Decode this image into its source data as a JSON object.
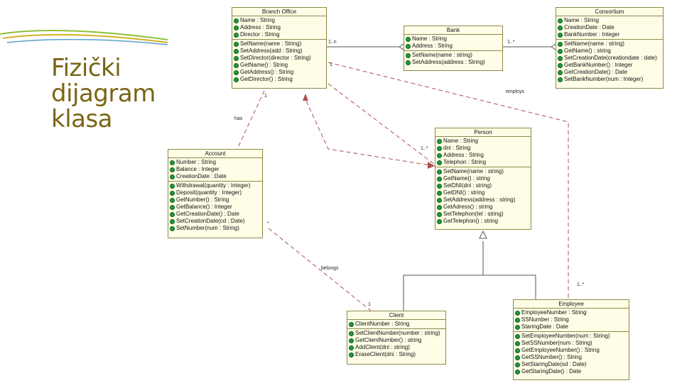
{
  "slide_title": "Fizički dijagram klasa",
  "colors": {
    "title": "#7a6414",
    "class_fill": "#fffde6",
    "class_border": "#8a8a4a",
    "icon_green": "#1e9a3a",
    "line_red": "#b05050"
  },
  "classes": {
    "branch_office": {
      "name": "Branch Office",
      "attributes": [
        "Name : String",
        "Address : String",
        "Director : String"
      ],
      "operations": [
        "SetName(name : String)",
        "SetAddress(add : String)",
        "SetDirector(director : String)",
        "GetName() : String",
        "GetAddress() : String",
        "GetDirector() : String"
      ]
    },
    "bank": {
      "name": "Bank",
      "attributes": [
        "Name : String",
        "Address : String"
      ],
      "operations": [
        "SetName(name : string)",
        "SetAddress(address : String)"
      ]
    },
    "consortium": {
      "name": "Consortium",
      "attributes": [
        "Name : String",
        "CreationDate : Date",
        "BankNumber : Integer"
      ],
      "operations": [
        "SetName(name : string)",
        "GetName() : string",
        "SetCreationDate(creationdate : date)",
        "GetBankNumber() : Integer",
        "GetCreationDate() : Date",
        "SetBankNumber(num : Integer)"
      ]
    },
    "account": {
      "name": "Account",
      "attributes": [
        "Number : String",
        "Balance : Integer",
        "CreationDate : Date"
      ],
      "operations": [
        "Withdrawal(quantity : Integer)",
        "Deposit(quantity : Integer)",
        "GetNumber() : String",
        "GetBalance() : Integer",
        "GetCreationDate() : Date",
        "SetCreationDate(cd : Date)",
        "SetNumber(num : String)"
      ]
    },
    "person": {
      "name": "Person",
      "attributes": [
        "Name : String",
        "dni : String",
        "Address : String",
        "Telephon : String"
      ],
      "operations": [
        "SetName(name : string)",
        "GetName() : string",
        "SetDNI(dni : string)",
        "GetDNI() : string",
        "SetAddress(address : string)",
        "GetAdress() : string",
        "SetTelephon(tel : string)",
        "GetTelephon() : string"
      ]
    },
    "client": {
      "name": "Client",
      "attributes": [
        "ClientNumber : String"
      ],
      "operations": [
        "SetClientNumber(number : string)",
        "GetClientNumber() : string",
        "AddClient(dni : string)",
        "EraseClient(dni : String)"
      ]
    },
    "employee": {
      "name": "Employee",
      "attributes": [
        "EmployeeNumber : String",
        "SSNumber : String",
        "StaringDate : Date"
      ],
      "operations": [
        "SetEmployeeNumber(num : String)",
        "SetSSNumber(num : String)",
        "GetEmployeeNumber() : String",
        "GetSSNumber() : String",
        "SetStaringDate(sd : Date)",
        "GetStaringDate() : Date"
      ]
    }
  },
  "labels": {
    "m_bo_bank": "1..n",
    "m_bank_cons": "1..*",
    "m_bo_1": "1",
    "m_bo_1b": "1",
    "m_person": "1..*",
    "m_acc_star": "*",
    "m_client_1": "1",
    "m_emp": "1..*",
    "employs": "employs",
    "has": "has",
    "belongs": "belongs"
  }
}
